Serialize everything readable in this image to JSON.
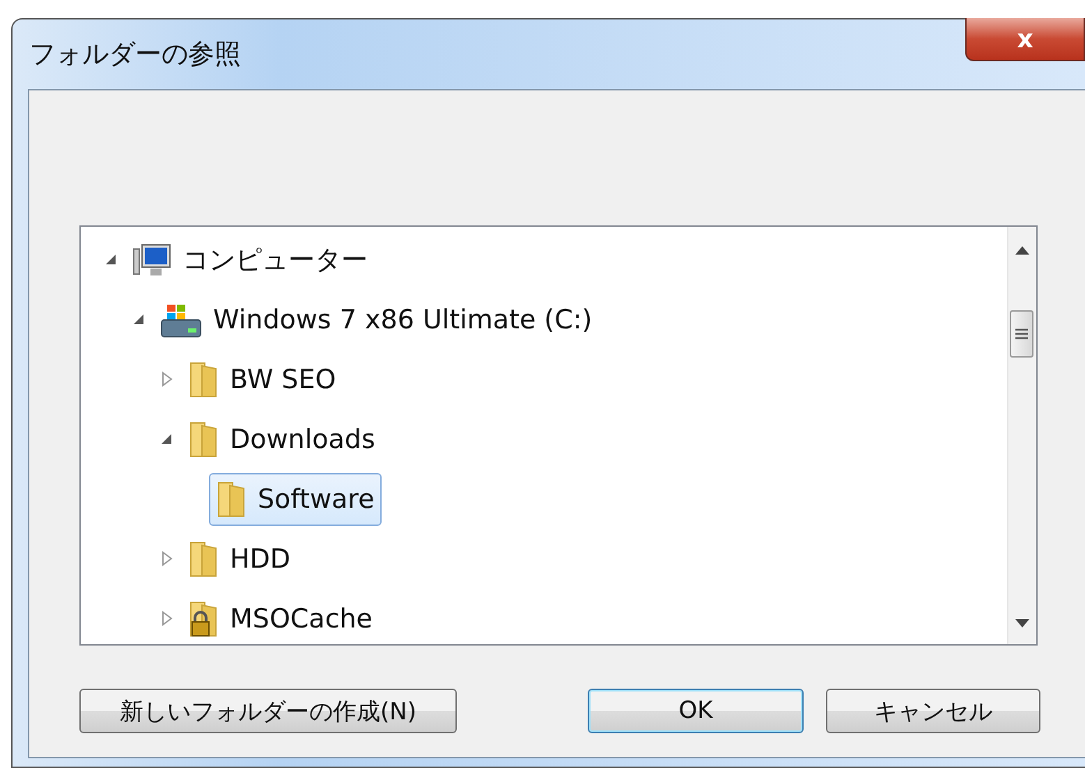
{
  "window": {
    "title": "フォルダーの参照",
    "close": "x"
  },
  "tree": [
    {
      "label": "コンピューター",
      "kind": "computer",
      "expandable": true,
      "expanded": true,
      "selected": false,
      "children": [
        {
          "label": "Windows 7 x86 Ultimate (C:)",
          "kind": "drive",
          "expandable": true,
          "expanded": true,
          "selected": false,
          "children": [
            {
              "label": "BW SEO",
              "kind": "folder",
              "expandable": true,
              "expanded": false,
              "selected": false
            },
            {
              "label": "Downloads",
              "kind": "folder",
              "expandable": true,
              "expanded": true,
              "selected": false,
              "children": [
                {
                  "label": "Software",
                  "kind": "folder",
                  "expandable": false,
                  "selected": true
                }
              ]
            },
            {
              "label": "HDD",
              "kind": "folder",
              "expandable": true,
              "expanded": false,
              "selected": false
            },
            {
              "label": "MSOCache",
              "kind": "locked-folder",
              "expandable": true,
              "expanded": false,
              "selected": false
            }
          ]
        }
      ]
    }
  ],
  "buttons": [
    {
      "label": "新しいフォルダーの作成(N)",
      "kind": "new-folder",
      "focused": false
    },
    {
      "label": "OK",
      "kind": "ok",
      "focused": true
    },
    {
      "label": "キャンセル",
      "kind": "cancel",
      "focused": false
    }
  ]
}
